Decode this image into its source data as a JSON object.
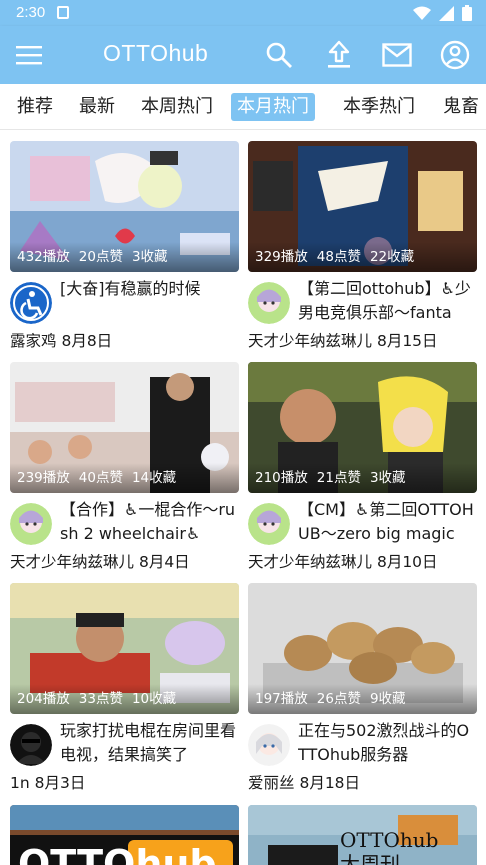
{
  "status": {
    "time": "2:30"
  },
  "app": {
    "title": "OTTOhub"
  },
  "icons": {
    "menu": "hamburger-menu-icon",
    "search": "search-icon",
    "upload": "upload-icon",
    "message": "mail-icon",
    "account": "account-circle-icon"
  },
  "colors": {
    "primary": "#7ec3f2",
    "text": "#1a1a1a",
    "stats_text": "#ffffff"
  },
  "tabs": [
    {
      "label": "推荐"
    },
    {
      "label": "最新"
    },
    {
      "label": "本周热门"
    },
    {
      "label": "本月热门",
      "active": true
    },
    {
      "label": "本季热门"
    },
    {
      "label": "鬼畜"
    }
  ],
  "videos": [
    {
      "views": "432播放",
      "likes": "20点赞",
      "favs": "3收藏",
      "title": "[大奋]有稳赢的时候",
      "author": "露家鸡",
      "date": "8月8日"
    },
    {
      "views": "329播放",
      "likes": "48点赞",
      "favs": "22收藏",
      "title": "【第二回ottohub】♿少男电竞俱乐部～fanta",
      "author": "天才少年纳兹琳儿",
      "date": "8月15日"
    },
    {
      "views": "239播放",
      "likes": "40点赞",
      "favs": "14收藏",
      "title": "【合作】♿一棍合作～rush 2 wheelchair♿",
      "author": "天才少年纳兹琳儿",
      "date": "8月4日"
    },
    {
      "views": "210播放",
      "likes": "21点赞",
      "favs": "3收藏",
      "title": "【CM】♿第二回OTTOHUB～zero big magic",
      "author": "天才少年纳兹琳儿",
      "date": "8月10日"
    },
    {
      "views": "204播放",
      "likes": "33点赞",
      "favs": "10收藏",
      "title": "玩家打扰电棍在房间里看电视，结果搞笑了",
      "author": "1n",
      "date": "8月3日"
    },
    {
      "views": "197播放",
      "likes": "26点赞",
      "favs": "9收藏",
      "title": "正在与502激烈战斗的OTTOhub服务器",
      "author": "爱丽丝",
      "date": "8月18日"
    },
    {
      "thumb_text": "OTTOhub"
    },
    {
      "thumb_text": "OTTOhub",
      "thumb_subtext": "大周刊"
    }
  ]
}
